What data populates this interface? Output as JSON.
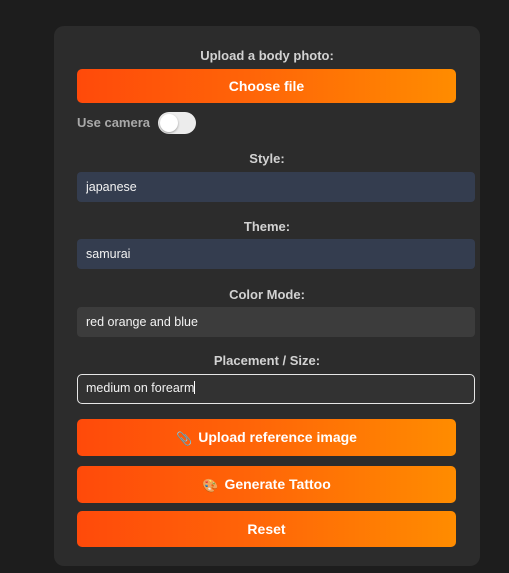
{
  "upload": {
    "label": "Upload a body photo:",
    "button": "Choose file"
  },
  "camera": {
    "label": "Use camera",
    "enabled": false
  },
  "style": {
    "label": "Style:",
    "value": "japanese"
  },
  "theme": {
    "label": "Theme:",
    "value": "samurai"
  },
  "color_mode": {
    "label": "Color Mode:",
    "value": "red orange and blue"
  },
  "placement": {
    "label": "Placement / Size:",
    "value": "medium on forearm"
  },
  "actions": {
    "upload_reference": "Upload reference image",
    "upload_reference_icon": "📎",
    "generate": "Generate Tattoo",
    "generate_icon": "🎨",
    "reset": "Reset"
  },
  "colors": {
    "page_bg": "#1d1d1d",
    "panel_bg": "#2c2c2c",
    "accent_start": "#ff4a0a",
    "accent_end": "#ff8c00",
    "input_blue": "#343d4f",
    "input_gray": "#3c3c3c"
  },
  "icons": {
    "upload_reference": "paperclip-icon",
    "generate": "palette-icon"
  }
}
